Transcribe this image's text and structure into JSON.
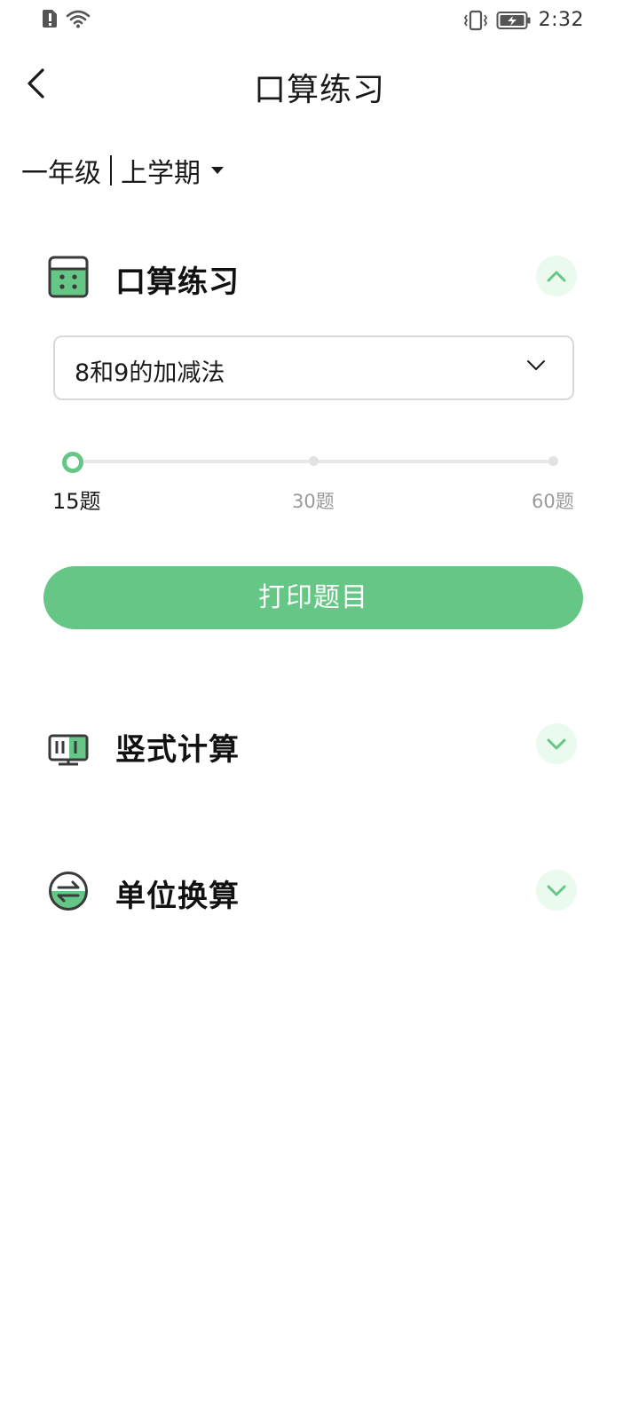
{
  "status_bar": {
    "time": "2:32",
    "icons": [
      "alert-icon",
      "wifi-icon",
      "vibrate-icon",
      "battery-icon"
    ]
  },
  "header": {
    "title": "口算练习",
    "back_icon": "back-arrow-icon"
  },
  "grade_selector": {
    "grade": "一年级",
    "term": "上学期"
  },
  "sections": [
    {
      "title": "口算练习",
      "icon": "calculator-icon",
      "expanded": true,
      "dropdown_value": "8和9的加减法",
      "slider": {
        "labels": [
          "15题",
          "30题",
          "60题"
        ],
        "selected_index": 0
      },
      "print_label": "打印题目"
    },
    {
      "title": "竖式计算",
      "icon": "vertical-calc-icon",
      "expanded": false
    },
    {
      "title": "单位换算",
      "icon": "unit-convert-icon",
      "expanded": false
    }
  ],
  "colors": {
    "accent": "#66c685",
    "accent_light": "#ebfaef",
    "icon_dark": "#3a3a3a"
  }
}
